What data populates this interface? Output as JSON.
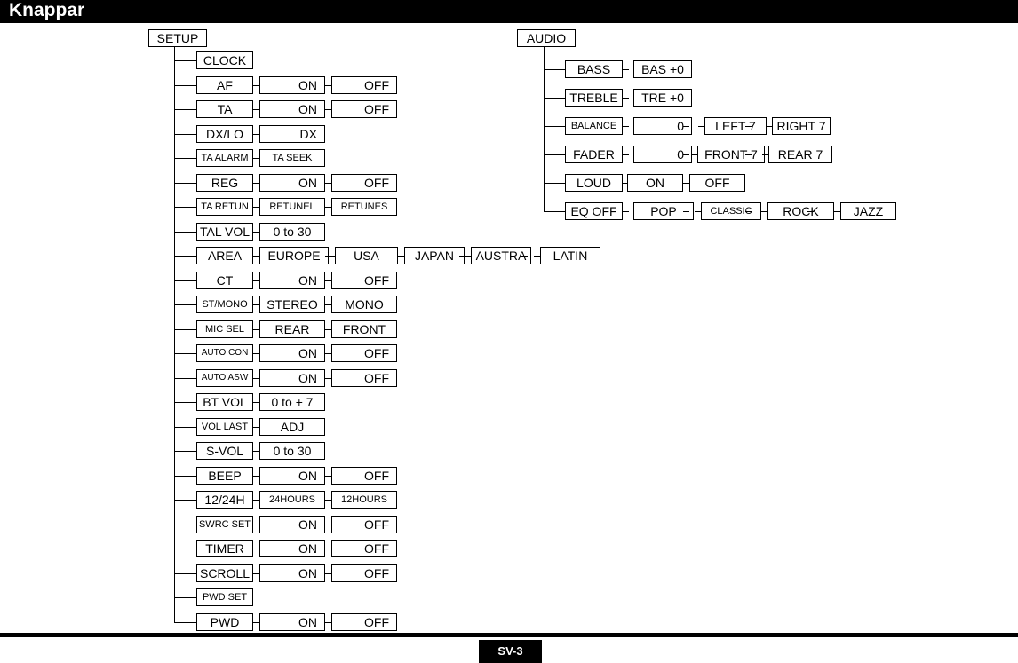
{
  "header": {
    "title": "Knappar"
  },
  "footer": {
    "page_label": "SV-3"
  },
  "diagram": {
    "setup": {
      "root_label": "SETUP",
      "rows": [
        {
          "label": "CLOCK",
          "values": []
        },
        {
          "label": "AF",
          "values": [
            "ON",
            "OFF"
          ]
        },
        {
          "label": "TA",
          "values": [
            "ON",
            "OFF"
          ]
        },
        {
          "label": "DX/LO",
          "values": [
            "DX"
          ]
        },
        {
          "label": "TA ALARM",
          "values": [
            "TA SEEK"
          ]
        },
        {
          "label": "REG",
          "values": [
            "ON",
            "OFF"
          ]
        },
        {
          "label": "TA RETUN",
          "values": [
            "RETUNEL",
            "RETUNES"
          ]
        },
        {
          "label": "TAL VOL",
          "values": [
            "0 to 30"
          ]
        },
        {
          "label": "AREA",
          "values": [
            "EUROPE",
            "USA",
            "JAPAN",
            "AUSTRA",
            "LATIN"
          ]
        },
        {
          "label": "CT",
          "values": [
            "ON",
            "OFF"
          ]
        },
        {
          "label": "ST/MONO",
          "values": [
            "STEREO",
            "MONO"
          ]
        },
        {
          "label": "MIC SEL",
          "values": [
            "REAR",
            "FRONT"
          ]
        },
        {
          "label": "AUTO CON",
          "values": [
            "ON",
            "OFF"
          ]
        },
        {
          "label": "AUTO ASW",
          "values": [
            "ON",
            "OFF"
          ]
        },
        {
          "label": "BT VOL",
          "values": [
            "0 to + 7"
          ]
        },
        {
          "label": "VOL LAST",
          "values": [
            "ADJ"
          ]
        },
        {
          "label": "S-VOL",
          "values": [
            "0 to 30"
          ]
        },
        {
          "label": "BEEP",
          "values": [
            "ON",
            "OFF"
          ]
        },
        {
          "label": "12/24H",
          "values": [
            "24HOURS",
            "12HOURS"
          ]
        },
        {
          "label": "SWRC SET",
          "values": [
            "ON",
            "OFF"
          ]
        },
        {
          "label": "TIMER",
          "values": [
            "ON",
            "OFF"
          ]
        },
        {
          "label": "SCROLL",
          "values": [
            "ON",
            "OFF"
          ]
        },
        {
          "label": "PWD SET",
          "values": []
        },
        {
          "label": "PWD",
          "values": [
            "ON",
            "OFF"
          ]
        }
      ]
    },
    "audio": {
      "root_label": "AUDIO",
      "rows": [
        {
          "label": "BASS",
          "values": [
            "BAS +0"
          ]
        },
        {
          "label": "TREBLE",
          "values": [
            "TRE +0"
          ]
        },
        {
          "label": "BALANCE",
          "values": [
            "0",
            "LEFT 7",
            "RIGHT 7"
          ]
        },
        {
          "label": "FADER",
          "values": [
            "0",
            "FRONT 7",
            "REAR 7"
          ]
        },
        {
          "label": "LOUD",
          "values": [
            "ON",
            "OFF"
          ]
        },
        {
          "label": "EQ OFF",
          "values": [
            "POP",
            "CLASSIC",
            "ROCK",
            "JAZZ"
          ]
        }
      ]
    }
  },
  "colors": {
    "ink": "#000000",
    "paper": "#ffffff"
  }
}
